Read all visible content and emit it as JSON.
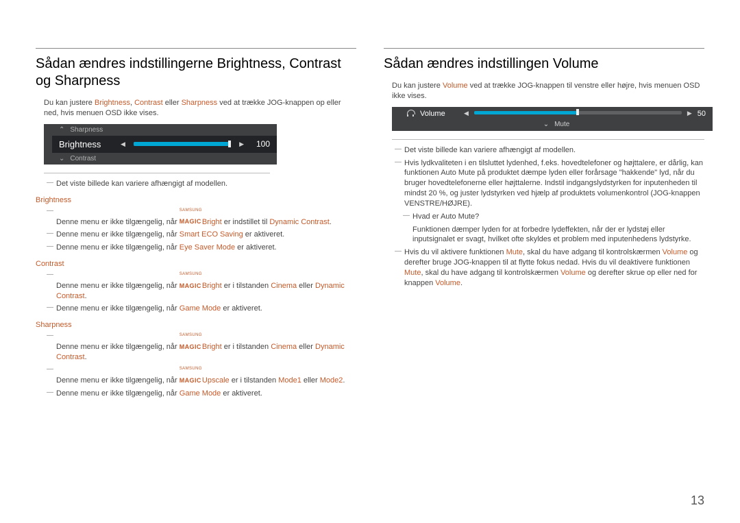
{
  "page_number": "13",
  "left": {
    "heading": "Sådan ændres indstillingerne Brightness, Contrast og Sharpness",
    "intro": {
      "t1": "Du kan justere ",
      "b": "Brightness",
      "t2": ", ",
      "c": "Contrast",
      "t3": " eller ",
      "s": "Sharpness",
      "t4": " ved at trække JOG-knappen op eller ned, hvis menuen OSD ikke vises."
    },
    "osd": {
      "up_label": "Sharpness",
      "selected_label": "Brightness",
      "selected_value": "100",
      "down_label": "Contrast"
    },
    "note1": "Det viste billede kan variere afhængigt af modellen.",
    "sec_brightness": {
      "title": "Brightness",
      "l1": {
        "p1": "Denne menu er ikke tilgængelig, når ",
        "bright": "Bright",
        "p2": " er indstillet til ",
        "dc": "Dynamic Contrast",
        "p3": "."
      },
      "l2": {
        "p1": "Denne menu er ikke tilgængelig, når ",
        "eco": "Smart ECO Saving",
        "p2": " er aktiveret."
      },
      "l3": {
        "p1": "Denne menu er ikke tilgængelig, når ",
        "esm": "Eye Saver Mode",
        "p2": " er aktiveret."
      }
    },
    "sec_contrast": {
      "title": "Contrast",
      "l1": {
        "p1": "Denne menu er ikke tilgængelig, når ",
        "bright": "Bright",
        "p2": " er i tilstanden ",
        "cin": "Cinema",
        "p3": " eller ",
        "dc": "Dynamic Contrast",
        "p4": "."
      },
      "l2": {
        "p1": "Denne menu er ikke tilgængelig, når ",
        "gm": "Game Mode",
        "p2": " er aktiveret."
      }
    },
    "sec_sharpness": {
      "title": "Sharpness",
      "l1": {
        "p1": "Denne menu er ikke tilgængelig, når ",
        "bright": "Bright",
        "p2": " er i tilstanden ",
        "cin": "Cinema",
        "p3": " eller ",
        "dc": "Dynamic Contrast",
        "p4": "."
      },
      "l2": {
        "p1": "Denne menu er ikke tilgængelig, når ",
        "up": "Upscale",
        "p2": " er i tilstanden ",
        "m1": "Mode1",
        "p3": " eller ",
        "m2": "Mode2",
        "p4": "."
      },
      "l3": {
        "p1": "Denne menu er ikke tilgængelig, når ",
        "gm": "Game Mode",
        "p2": " er aktiveret."
      }
    }
  },
  "right": {
    "heading": "Sådan ændres indstillingen Volume",
    "intro": {
      "t1": "Du kan justere ",
      "v": "Volume",
      "t2": " ved at trække JOG-knappen til venstre eller højre, hvis menuen OSD ikke vises."
    },
    "osd": {
      "label": "Volume",
      "value": "50",
      "mute_label": "Mute"
    },
    "note1": "Det viste billede kan variere afhængigt af modellen.",
    "n2": "Hvis lydkvaliteten i en tilsluttet lydenhed, f.eks. hovedtelefoner og højttalere, er dårlig, kan funktionen Auto Mute på produktet dæmpe lyden eller forårsage \"hakkende\" lyd, når du bruger hovedtelefonerne eller højttalerne. Indstil indgangslydstyrken for inputenheden til mindst 20 %, og juster lydstyrken ved hjælp af produktets volumenkontrol (JOG-knappen VENSTRE/HØJRE).",
    "n2q": "Hvad er Auto Mute?",
    "n2q_a": "Funktionen dæmper lyden for at forbedre lydeffekten, når der er lydstøj eller inputsignalet er svagt, hvilket ofte skyldes et problem med inputenhedens lydstyrke.",
    "n3": {
      "p1": "Hvis du vil aktivere funktionen ",
      "mute": "Mute",
      "p2": ", skal du have adgang til kontrolskærmen ",
      "vol": "Volume",
      "p3": " og derefter bruge JOG-knappen til at flytte fokus nedad. Hvis du vil deaktivere funktionen ",
      "mute2": "Mute",
      "p4": ", skal du have adgang til kontrolskærmen ",
      "vol2": "Volume",
      "p5": " og derefter skrue op eller ned for knappen ",
      "vol3": "Volume",
      "p6": "."
    }
  }
}
